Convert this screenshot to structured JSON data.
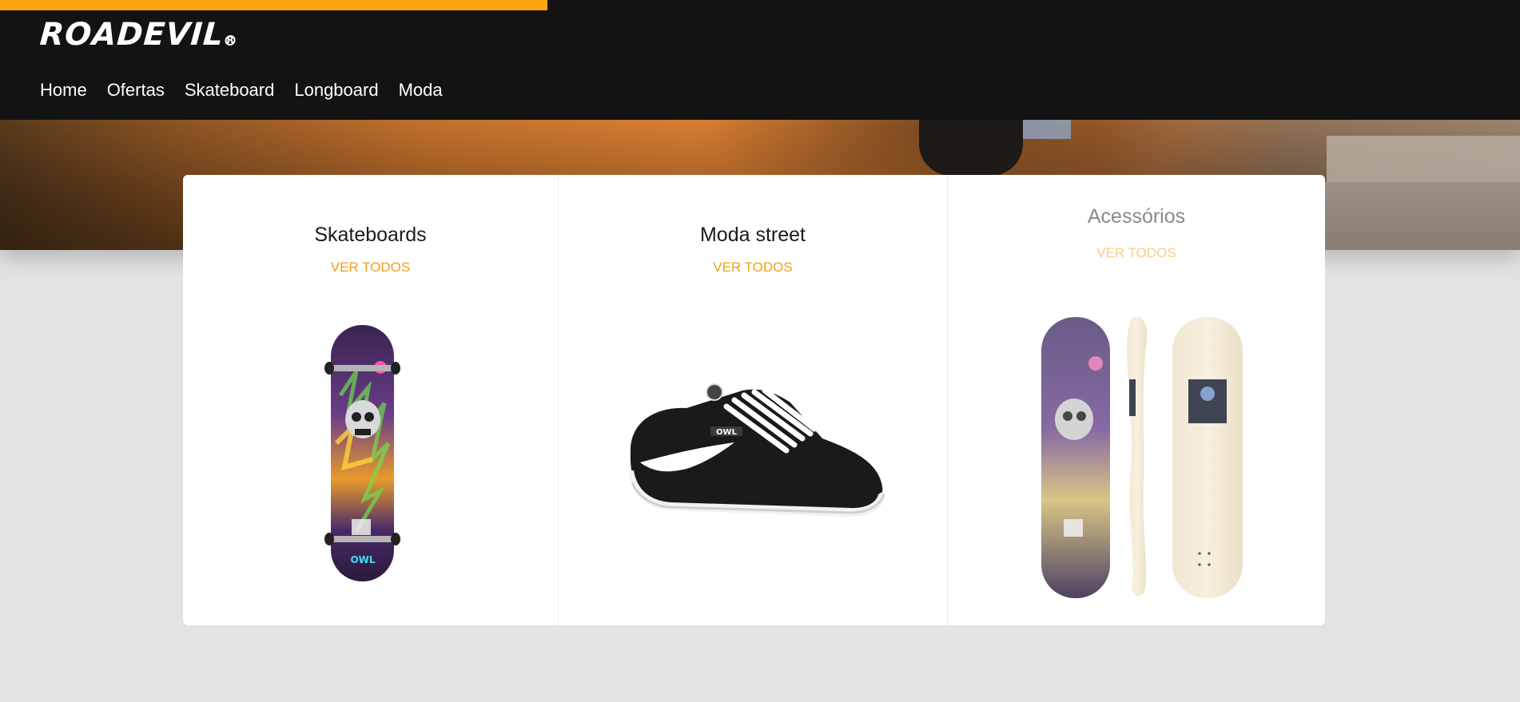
{
  "header": {
    "logo_text": "ROADEVIL",
    "logo_mark": "R",
    "accent_color": "#f9a612"
  },
  "nav": {
    "items": [
      {
        "label": "Home"
      },
      {
        "label": "Ofertas"
      },
      {
        "label": "Skateboard"
      },
      {
        "label": "Longboard"
      },
      {
        "label": "Moda"
      }
    ]
  },
  "categories": [
    {
      "title": "Skateboards",
      "link": "VER TODOS",
      "image": "complete-skateboard-image"
    },
    {
      "title": "Moda street",
      "link": "VER TODOS",
      "image": "sneaker-image"
    },
    {
      "title": "Acessórios",
      "link": "VER TODOS",
      "image": "skate-decks-image"
    }
  ],
  "brand_text": "OWL"
}
